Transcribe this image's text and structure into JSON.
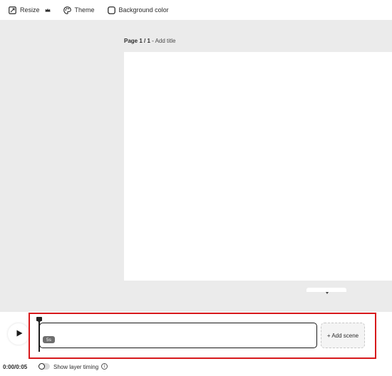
{
  "toolbar": {
    "resize_label": "Resize",
    "resize_icon": "resize-icon",
    "premium_icon": "crown-icon",
    "theme_label": "Theme",
    "theme_icon": "palette-icon",
    "background_label": "Background color",
    "background_icon": "color-swatch-icon"
  },
  "canvas": {
    "page_indicator": "Page 1 / 1",
    "separator": " - ",
    "add_title": "Add title",
    "background_color": "#ebebeb",
    "page_color": "#ffffff"
  },
  "timeline": {
    "play_icon": "play-icon",
    "scene_duration": "5s",
    "add_scene_label": "+ Add scene",
    "time_readout": "0:00/0:05",
    "show_layer_timing_label": "Show layer timing",
    "show_layer_timing_enabled": false,
    "info_icon": "info-icon",
    "info_glyph": "i",
    "highlight_color": "#d7191c"
  }
}
